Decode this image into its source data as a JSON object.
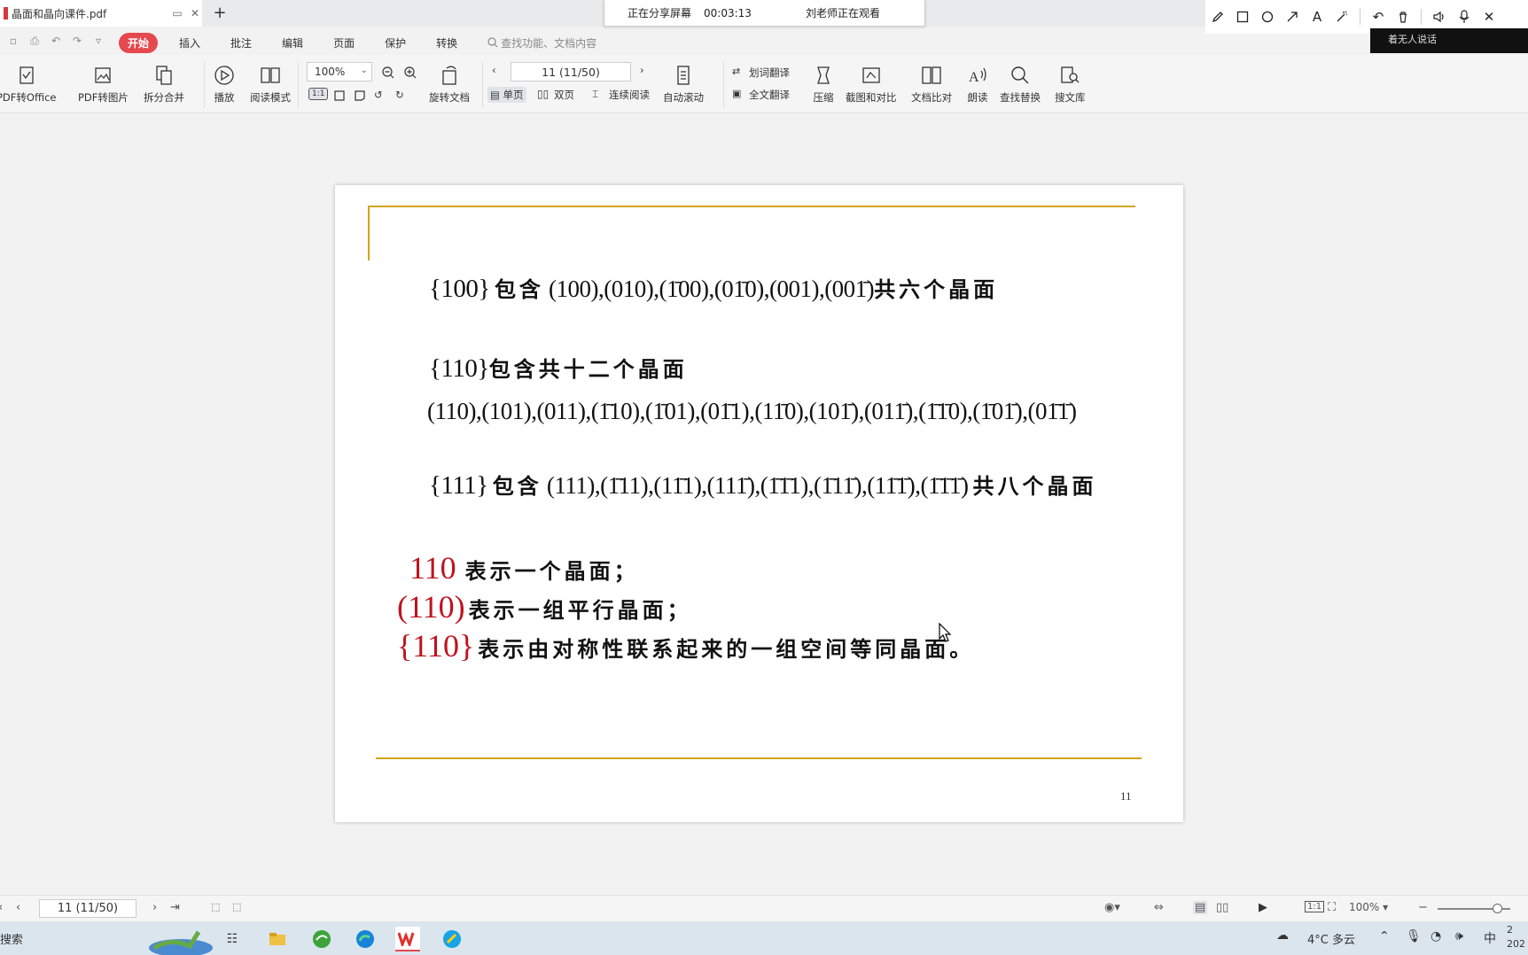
{
  "window": {
    "tab_title": "晶面和晶向课件.pdf",
    "new_tab": "+"
  },
  "share_bar": {
    "status": "正在分享屏幕",
    "timer": "00:03:13",
    "viewer": "刘老师正在观看"
  },
  "overlay_text": "着无人说话",
  "ribbon": {
    "tabs": [
      "开始",
      "插入",
      "批注",
      "编辑",
      "页面",
      "保护",
      "转换"
    ],
    "search_placeholder": "查找功能、文档内容"
  },
  "toolbar": {
    "pdf_to_office": "PDF转Office",
    "pdf_to_image": "PDF转图片",
    "split_merge": "拆分合并",
    "play": "播放",
    "read_mode": "阅读模式",
    "zoom": "100%",
    "rotate_doc": "旋转文档",
    "page_indicator": "11 (11/50)",
    "single_page": "单页",
    "double_page": "双页",
    "continuous": "连续阅读",
    "auto_scroll": "自动滚动",
    "word_translate": "划词翻译",
    "full_translate": "全文翻译",
    "compress": "压缩",
    "screenshot_compare": "截图和对比",
    "doc_compare": "文档比对",
    "read_aloud": "朗读",
    "find_replace": "查找替换",
    "search_library": "搜文库"
  },
  "document": {
    "line1": {
      "set": "{100}",
      "verb": "包含",
      "planes": "(100),(010),(1̄00),(01̄0),(001),(001̄)",
      "tail": "共六个晶面"
    },
    "line2": {
      "set": "{110}",
      "tail": "包含共十二个晶面"
    },
    "line3": {
      "planes": "(110),(101),(011),(1̄10),(1̄01),(01̄1),(11̄0),(101̄),(011̄),(1̄1̄0),(1̄01̄),(01̄1̄)"
    },
    "line4": {
      "set": "{111}",
      "verb": "包含",
      "planes": "(111),(1̄11),(11̄1),(111̄),(1̄1̄1),(1̄11̄),(11̄1̄),(1̄1̄1̄)",
      "tail": "共八个晶面"
    },
    "def1": {
      "term": "110",
      "text": "表示一个晶面；"
    },
    "def2": {
      "term": "(110)",
      "text": "表示一组平行晶面；"
    },
    "def3": {
      "term": "{110}",
      "text": "表示由对称性联系起来的一组空间等同晶面。"
    },
    "page_number": "11"
  },
  "statusbar": {
    "page_indicator": "11 (11/50)",
    "zoom": "100%"
  },
  "taskbar": {
    "search_text": "搜索",
    "weather": "4°C  多云",
    "ime": "中",
    "clock_partial": "2\n202"
  }
}
